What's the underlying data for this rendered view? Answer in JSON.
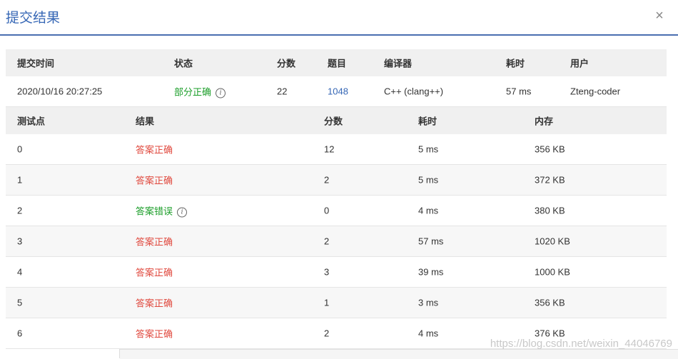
{
  "dialog": {
    "title": "提交结果",
    "close_glyph": "×"
  },
  "summary": {
    "headers": [
      "提交时间",
      "状态",
      "分数",
      "题目",
      "编译器",
      "耗时",
      "用户"
    ],
    "row": {
      "time": "2020/10/16 20:27:25",
      "status": "部分正确",
      "score": "22",
      "problem": "1048",
      "compiler": "C++ (clang++)",
      "duration": "57 ms",
      "user": "Zteng-coder"
    }
  },
  "cases": {
    "headers": [
      "测试点",
      "结果",
      "分数",
      "耗时",
      "内存"
    ],
    "rows": [
      {
        "id": "0",
        "result": "答案正确",
        "score": "12",
        "time": "5 ms",
        "memory": "356 KB"
      },
      {
        "id": "1",
        "result": "答案正确",
        "score": "2",
        "time": "5 ms",
        "memory": "372 KB"
      },
      {
        "id": "2",
        "result": "答案错误",
        "score": "0",
        "time": "4 ms",
        "memory": "380 KB"
      },
      {
        "id": "3",
        "result": "答案正确",
        "score": "2",
        "time": "57 ms",
        "memory": "1020 KB"
      },
      {
        "id": "4",
        "result": "答案正确",
        "score": "3",
        "time": "39 ms",
        "memory": "1000 KB"
      },
      {
        "id": "5",
        "result": "答案正确",
        "score": "1",
        "time": "3 ms",
        "memory": "356 KB"
      },
      {
        "id": "6",
        "result": "答案正确",
        "score": "2",
        "time": "4 ms",
        "memory": "376 KB"
      }
    ]
  },
  "watermark": "https://blog.csdn.net/weixin_44046769",
  "colors": {
    "accent": "#3566b5",
    "correct": "#e04a3f",
    "wrong": "#1c9e2a"
  }
}
